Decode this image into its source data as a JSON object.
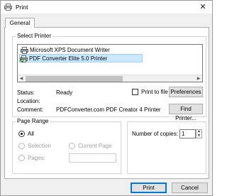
{
  "window": {
    "title": "Print",
    "close_glyph": "✕"
  },
  "tabs": [
    {
      "label": "General",
      "selected": true
    }
  ],
  "select_printer": {
    "label": "Select Printer",
    "printers": [
      {
        "name": "Microsoft XPS Document Writer",
        "icon": "printer-icon",
        "selected": false
      },
      {
        "name": "PDF Converter Elite 5.0 Printer",
        "icon": "printer-default-icon",
        "selected": true
      }
    ],
    "status_label": "Status:",
    "status_value": "Ready",
    "location_label": "Location:",
    "location_value": "",
    "comment_label": "Comment:",
    "comment_value": "PDFConverter.com PDF Creator 4 Printer",
    "print_to_file_label": "Print to file",
    "print_to_file_checked": false,
    "preferences_label": "Preferences",
    "find_printer_label": "Find Printer..."
  },
  "page_range": {
    "label": "Page Range",
    "options": [
      {
        "label": "All",
        "selected": true,
        "enabled": true
      },
      {
        "label": "Selection",
        "selected": false,
        "enabled": false
      },
      {
        "label": "Current Page",
        "selected": false,
        "enabled": false
      },
      {
        "label": "Pages:",
        "selected": false,
        "enabled": false
      }
    ],
    "pages_value": ""
  },
  "copies": {
    "label": "Number of copies:",
    "value": "1"
  },
  "footer": {
    "print_label": "Print",
    "cancel_label": "Cancel"
  },
  "colors": {
    "accent": "#0078d7",
    "selection_bg": "#cce8ff",
    "dialog_bg": "#f0f0f0"
  }
}
